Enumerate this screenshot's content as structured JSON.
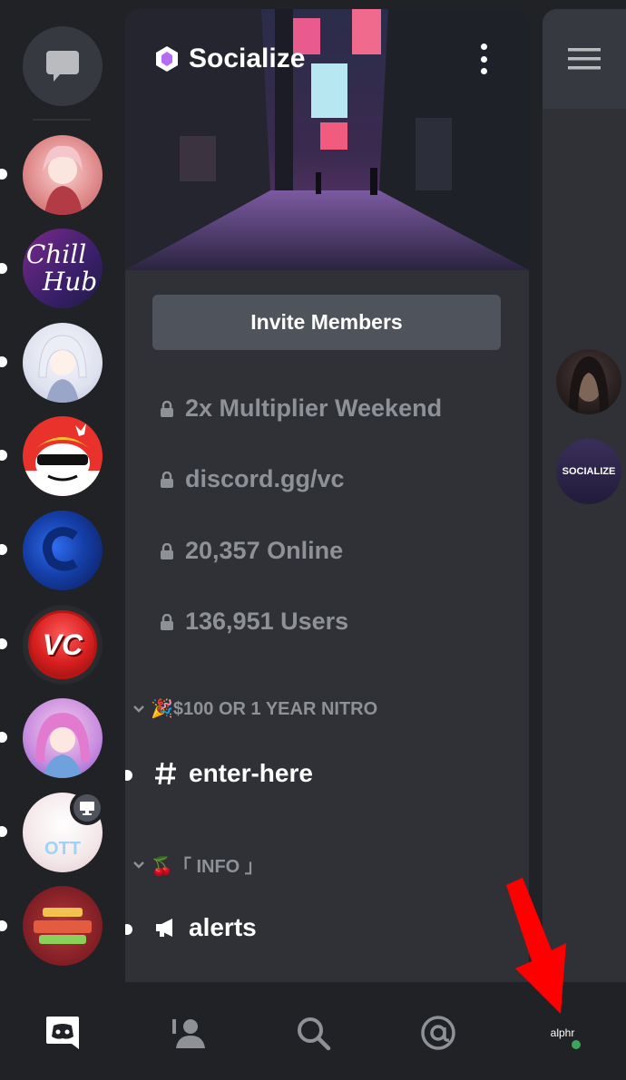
{
  "server": {
    "name": "Socialize",
    "invite_label": "Invite Members",
    "info": [
      {
        "text": "2x Multiplier Weekend"
      },
      {
        "text": "discord.gg/vc"
      },
      {
        "text": "20,357 Online"
      },
      {
        "text": "136,951 Users"
      }
    ],
    "categories": [
      {
        "label": "🎉$100 OR 1 YEAR NITRO",
        "channel": "enter-here",
        "channel_icon": "hash-icon"
      },
      {
        "label": "🍒「 INFO 」",
        "channel": "alerts",
        "channel_icon": "megaphone-icon"
      }
    ]
  },
  "servers": [
    {
      "name": "anime-pink"
    },
    {
      "name": "chill-hub",
      "label_line1": "Chill",
      "label_line2": "Hub"
    },
    {
      "name": "anime-white"
    },
    {
      "name": "reddit-sunglasses"
    },
    {
      "name": "blue-c"
    },
    {
      "name": "vc",
      "label": "VC"
    },
    {
      "name": "anime-purple"
    },
    {
      "name": "ott",
      "label": "OTT"
    },
    {
      "name": "red-logo"
    }
  ],
  "member_list": {
    "second_label": "SOCIALIZE"
  },
  "profile": {
    "label": "alphr",
    "status": "online"
  },
  "colors": {
    "background": "#202225",
    "panel": "#2f3136",
    "muted_text": "#8e9297",
    "online": "#3ba55c",
    "arrow": "#ff0000"
  }
}
